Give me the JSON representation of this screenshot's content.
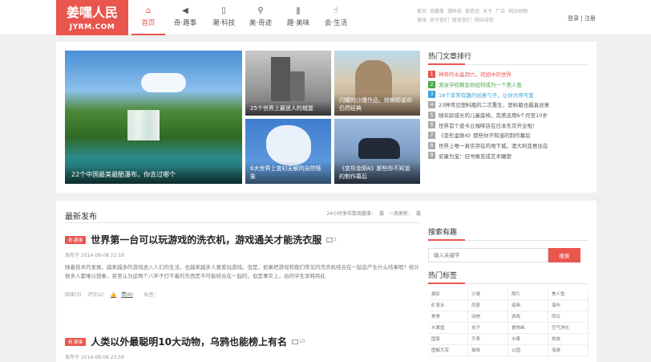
{
  "logo": {
    "title": "姜嘿人民",
    "subtitle": "JYRM.COM"
  },
  "nav": [
    {
      "label": "首页",
      "icon": "home-icon"
    },
    {
      "label": "奇·趣事",
      "icon": "megaphone-icon"
    },
    {
      "label": "潮·科技",
      "icon": "phone-icon"
    },
    {
      "label": "美·奇迹",
      "icon": "location-icon"
    },
    {
      "label": "趣·美味",
      "icon": "utensils-icon"
    },
    {
      "label": "会·生活",
      "icon": "thumbs-up-icon"
    }
  ],
  "toplinks": [
    "首页",
    "奇趣事",
    "潮科技",
    "美奇迹",
    "关于",
    "广告",
    "网站地图",
    "美味",
    "关于我们",
    "联系我们",
    "网站导航"
  ],
  "login": {
    "login": "登录",
    "sep": "|",
    "register": "注册"
  },
  "features": {
    "big_caption": "22个中国最美最酷瀑布，你去过哪个",
    "tiles": [
      "25个世界上最迷人的城堡",
      "闪耀的沙雕作品，转瞬即逝却仍然经典",
      "6大世界上变幻无解的自然怪象",
      "《变形金刚4》那些你不知道的制作幕后"
    ]
  },
  "hot": {
    "title": "热门文章排行",
    "items": [
      {
        "num": "1",
        "text": "神奇的水晶洞穴，宛如中的世界"
      },
      {
        "num": "2",
        "text": "游泳学校教会你如何成为一个美人鱼"
      },
      {
        "num": "3",
        "text": "18个非常有趣的创意勺子，让你大呼可爱"
      },
      {
        "num": "4",
        "text": "23种常见塑料瓶的二次重生，塑料瓶也最具创意"
      },
      {
        "num": "5",
        "text": "随年龄成长的儿童座椅，完美适用6个月至10岁"
      },
      {
        "num": "6",
        "text": "世界首个皮卡丘咖啡店在日本东京开业啦！"
      },
      {
        "num": "7",
        "text": "《变形金刚4》那些你不知道的制作幕后"
      },
      {
        "num": "8",
        "text": "世界上唯一真实存在的地下城，澳大利亚居住在"
      },
      {
        "num": "9",
        "text": "安康为宝：旧书报变成艺术雕塑"
      }
    ]
  },
  "latest": {
    "title": "最新发布",
    "meta": [
      "24小时发布数周趣事：",
      "篇",
      "一周更新：",
      "篇"
    ],
    "articles": [
      {
        "tag": "奇·趣事",
        "title": "世界第一台可以玩游戏的洗衣机，游戏通关才能洗衣服",
        "comments": "1",
        "date": "发布于 2014-08-08 22:18",
        "desc": "随着技术的发展，越来越多的游戏进入人们的生活，也越来越多人喜爱玩游戏。但是，如果把游戏和我们常见的洗衣机结合在一起会产生什么结果呢？统计很多人都难以想象，甚至认为这两个八竿子打不着的东西是不可能结合在一起的。但是事实上，自的学生李韩将此",
        "stats": {
          "views": "阅读(3)",
          "comments": "评论(2)",
          "likes": "赞(0)",
          "tags": "标签："
        }
      },
      {
        "tag": "奇·趣事",
        "title": "人类以外最聪明10大动物，乌鸦也能榜上有名",
        "comments": "10",
        "date": "发布于 2014-08-08 23:59"
      }
    ]
  },
  "search": {
    "title": "搜索有趣",
    "placeholder": "输入关键字",
    "button": "搜索"
  },
  "tags": {
    "title": "热门标签",
    "items": [
      "摄影",
      "沙滩",
      "照片",
      "美人鱼",
      "矿泉水",
      "风景",
      "插画",
      "瀑布",
      "美食",
      "动物",
      "游戏",
      "西瓜",
      "水果盘",
      "孩子",
      "食物画",
      "空气净化",
      "国家",
      "手表",
      "水果",
      "旅游",
      "图解大赏",
      "猫咪",
      "公园",
      "海滩"
    ]
  },
  "colors": {
    "accent": "#e9564e",
    "green": "#4aa84a",
    "blue": "#3b9fd8"
  }
}
